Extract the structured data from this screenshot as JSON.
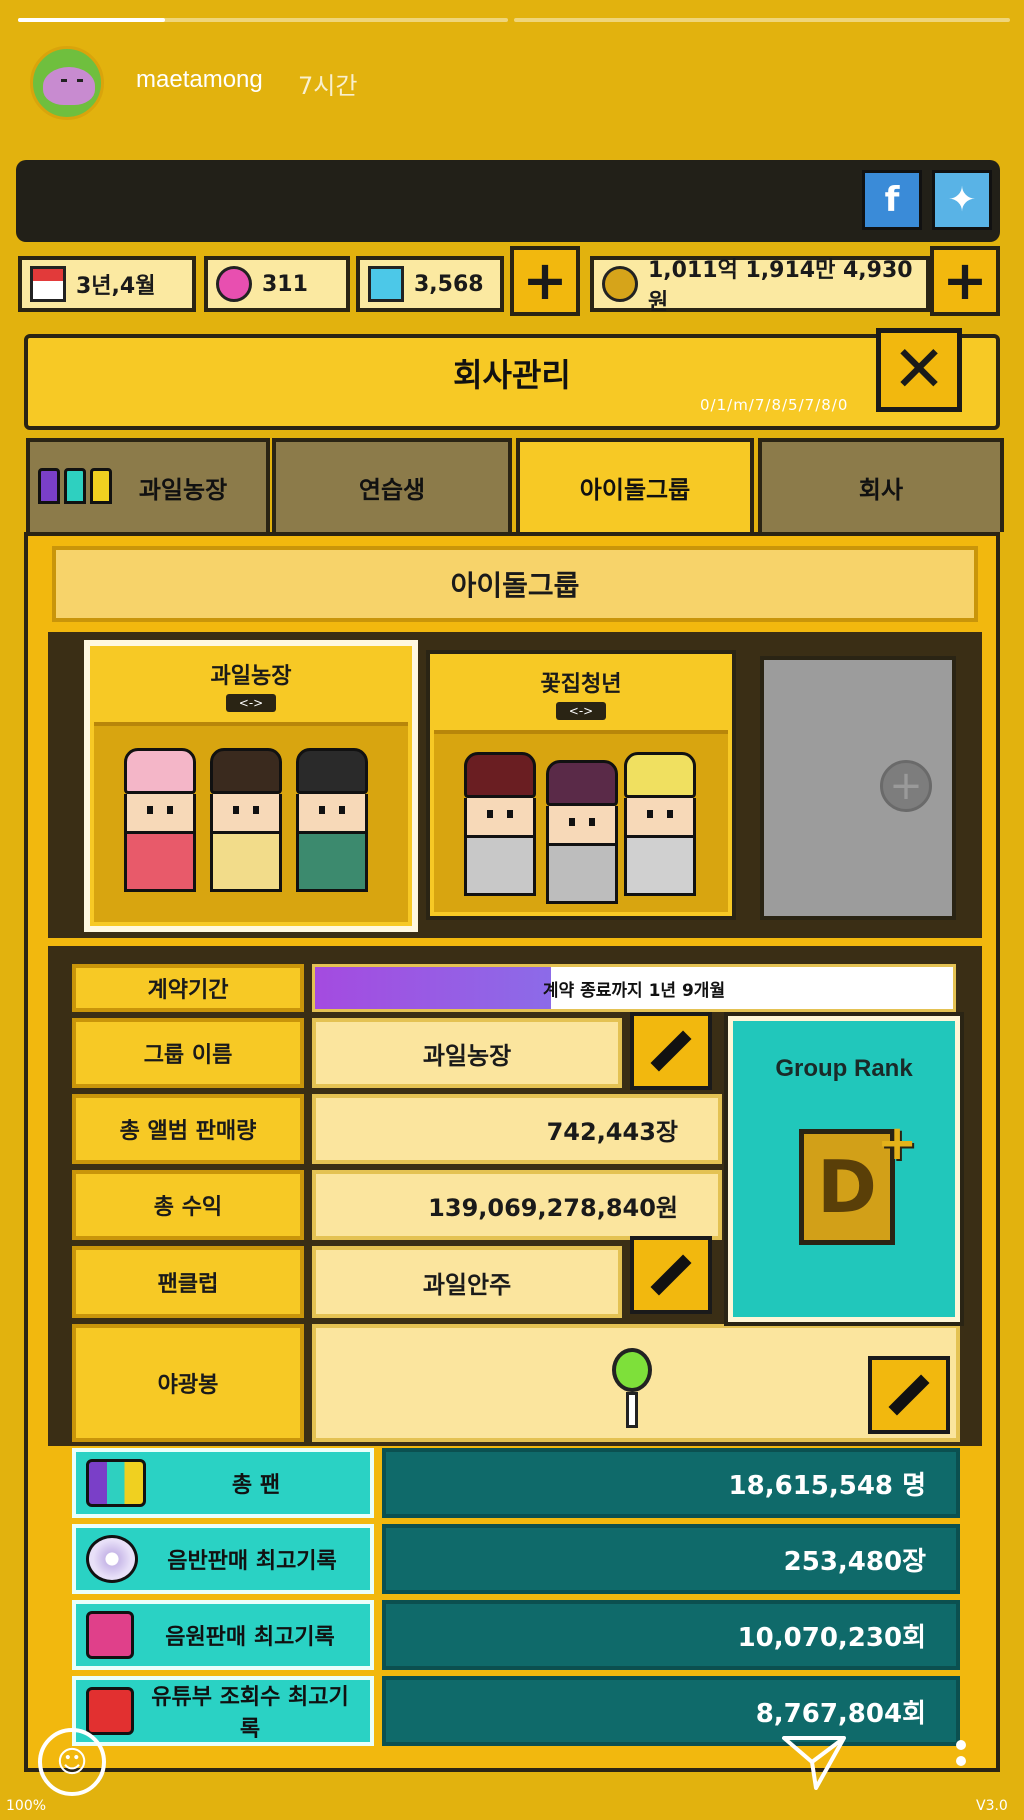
{
  "story": {
    "username": "maetamong",
    "time": "7시간",
    "progress": 0.3
  },
  "resources": {
    "date": "3년,4월",
    "gem_pink": "311",
    "gem_blue": "3,568",
    "money": "1,011억 1,914만 4,930원"
  },
  "window": {
    "title": "회사관리",
    "version": "0/1/m/7/8/5/7/8/0"
  },
  "tabs": [
    {
      "label": "과일농장"
    },
    {
      "label": "연습생"
    },
    {
      "label": "아이돌그룹"
    },
    {
      "label": "회사"
    }
  ],
  "section_title": "아이돌그룹",
  "groups": [
    {
      "name": "과일농장",
      "arrows": "<->"
    },
    {
      "name": "꽃집청년",
      "arrows": "<->"
    }
  ],
  "info": {
    "contract_label": "계약기간",
    "contract_text": "계약 종료까지 1년 9개월",
    "contract_progress": 0.37,
    "name_label": "그룹 이름",
    "name_value": "과일농장",
    "album_label": "총 앨범 판매량",
    "album_value": "742,443장",
    "revenue_label": "총 수익",
    "revenue_value": "139,069,278,840원",
    "fanclub_label": "팬클럽",
    "fanclub_value": "과일안주",
    "lightstick_label": "야광봉"
  },
  "rank": {
    "title": "Group Rank",
    "grade": "D",
    "modifier": "+"
  },
  "stats": [
    {
      "label": "총 팬",
      "value": "18,615,548 명",
      "icon": "fans-icon"
    },
    {
      "label": "음반판매 최고기록",
      "value": "253,480장",
      "icon": "disc-icon"
    },
    {
      "label": "음원판매 최고기록",
      "value": "10,070,230회",
      "icon": "music-note-icon"
    },
    {
      "label": "유튜부 조회수 최고기록",
      "value": "8,767,804회",
      "icon": "video-play-icon"
    }
  ],
  "overlay": {
    "zoom": "100%",
    "app_version": "V3.0"
  },
  "colors": {
    "background": "#e2b20e",
    "panel": "#f7c925",
    "teal_dark": "#0f6a6a",
    "teal_light": "#2ad2c4",
    "contract_fill": "#a44be0"
  }
}
